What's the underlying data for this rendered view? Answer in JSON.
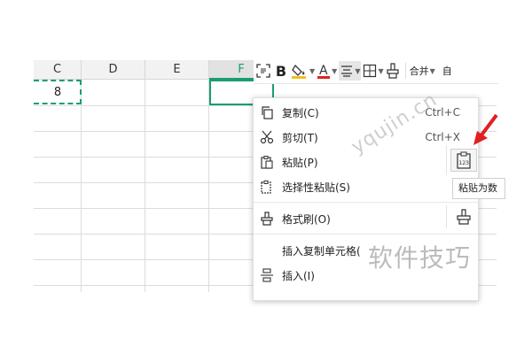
{
  "sheet": {
    "columns": [
      {
        "label": "C",
        "selected": false
      },
      {
        "label": "D",
        "selected": false
      },
      {
        "label": "E",
        "selected": false
      },
      {
        "label": "F",
        "selected": true
      }
    ],
    "copied_cell_value": "8"
  },
  "toolbar": {
    "bold_label": "B",
    "font_color_letter": "A",
    "merge_label": "合并",
    "auto_label": "自",
    "font_color": "#e02020",
    "fill_color": "#f0c020"
  },
  "context_menu": {
    "items": [
      {
        "label": "复制(C)",
        "shortcut": "Ctrl+C",
        "icon": "copy-icon"
      },
      {
        "label": "剪切(T)",
        "shortcut": "Ctrl+X",
        "icon": "scissors-icon"
      },
      {
        "label": "粘贴(P)",
        "shortcut": "",
        "icon": "paste-icon"
      },
      {
        "label": "选择性粘贴(S)",
        "shortcut": "",
        "icon": "paste-special-icon"
      },
      {
        "label": "格式刷(O)",
        "shortcut": "",
        "icon": "format-painter-icon"
      },
      {
        "label": "插入复制单元格(",
        "shortcut": "",
        "icon": ""
      },
      {
        "label": "插入(I)",
        "shortcut": "",
        "icon": "insert-icon"
      }
    ],
    "paste_values_button_text": "123",
    "tooltip": "粘贴为数"
  },
  "watermark": {
    "site": "yqujin.cn",
    "brand": "软件技巧"
  },
  "colors": {
    "accent": "#1a9e6e",
    "arrow": "#e02020"
  }
}
